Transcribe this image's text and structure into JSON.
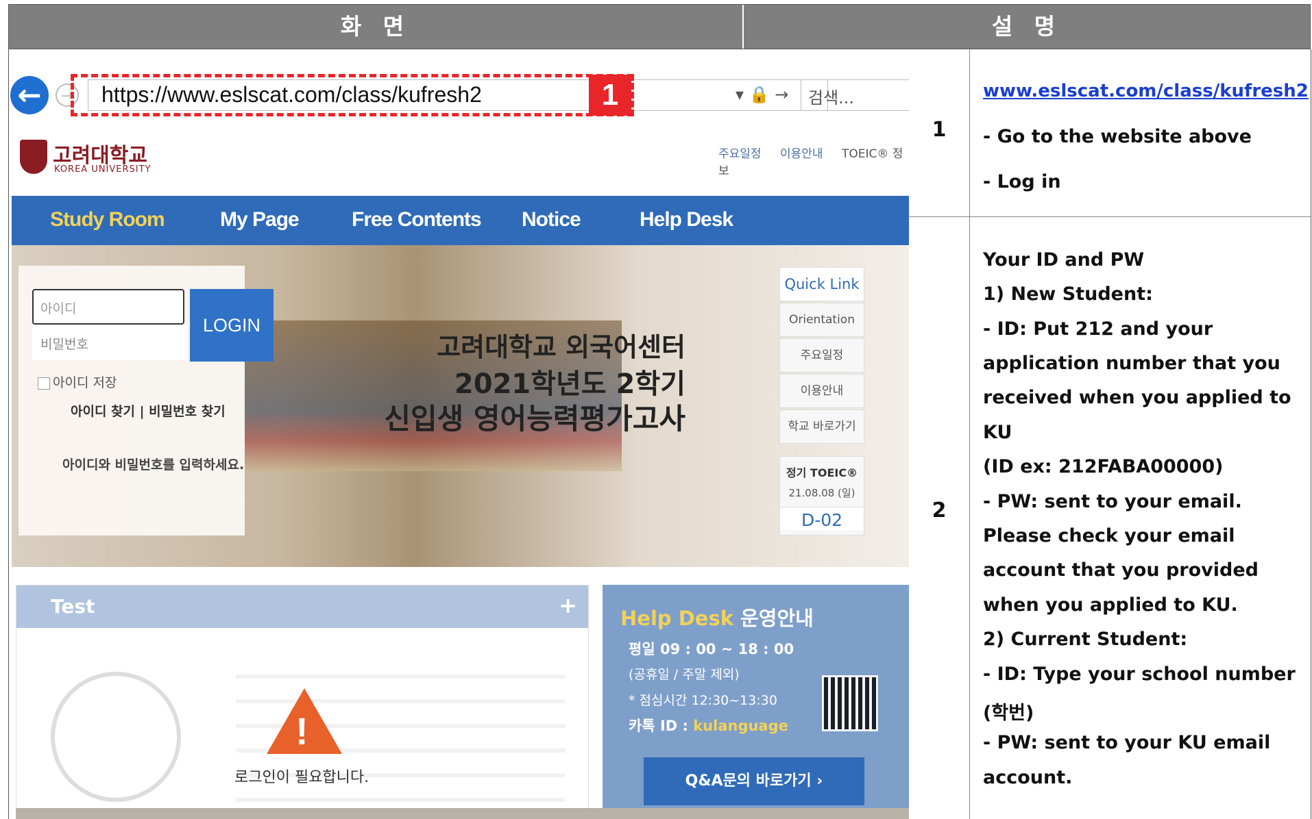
{
  "header": {
    "left": "화 면",
    "right": "설 명"
  },
  "browser": {
    "url": "https://www.eslscat.com/class/kufresh2",
    "search_placeholder": "검색...",
    "callout_number": "1",
    "url_tools": "▾ 🔒 →"
  },
  "site": {
    "logo_name": "고려대학교",
    "logo_eng": "KOREA UNIVERSITY",
    "top_links": [
      "주요일정",
      "이용안내",
      "TOEIC® 정보"
    ],
    "nav": [
      "Study Room",
      "My Page",
      "Free Contents",
      "Notice",
      "Help Desk"
    ],
    "login": {
      "id_placeholder": "아이디",
      "pw_placeholder": "비밀번호",
      "button": "LOGIN",
      "save_id": "아이디 저장",
      "find_links": "아이디 찾기  |  비밀번호 찾기",
      "hint": "아이디와 비밀번호를 입력하세요."
    },
    "hero": {
      "line1": "고려대학교 외국어센터",
      "line2": "2021학년도 2학기",
      "line3": "신입생 영어능력평가고사"
    },
    "quick": {
      "title": "Quick Link",
      "items": [
        "Orientation",
        "주요일정",
        "이용안내",
        "학교 바로가기"
      ],
      "toeic_title": "정기 TOEIC®",
      "toeic_date": "21.08.08 (일)",
      "dday": "D-02"
    },
    "test": {
      "title": "Test",
      "plus": "+",
      "need_login": "로그인이 필요합니다."
    },
    "help": {
      "title_en": "Help Desk",
      "title_ko": " 운영안내",
      "weekday": "평일 09 : 00 ~ 18 : 00",
      "holiday": "(공휴일 / 주말 제외)",
      "lunch": "* 점심시간 12:30~13:30",
      "kakao_label": "카톡 ID : ",
      "kakao_id": "kulanguage",
      "qa_button": "Q&A문의 바로가기  ›"
    }
  },
  "description": {
    "row1": {
      "number": "1",
      "link": "www.eslscat.com/class/kufresh2",
      "lines": [
        "-   Go to the website above",
        "-   Log in"
      ]
    },
    "row2": {
      "number": "2",
      "lines": [
        "Your ID and PW",
        "1) New Student:",
        "-   ID: Put 212 and your",
        "     application number that you",
        "     received when you applied to",
        "     KU",
        "   (ID ex: 212FABA00000)",
        "-   PW: sent to your email.",
        "     Please check your email",
        "     account that you provided",
        "     when you applied to KU.",
        "2) Current Student:",
        "-   ID: Type your school number",
        "     (학번)",
        "-   PW: sent to your KU email",
        "     account."
      ]
    }
  }
}
